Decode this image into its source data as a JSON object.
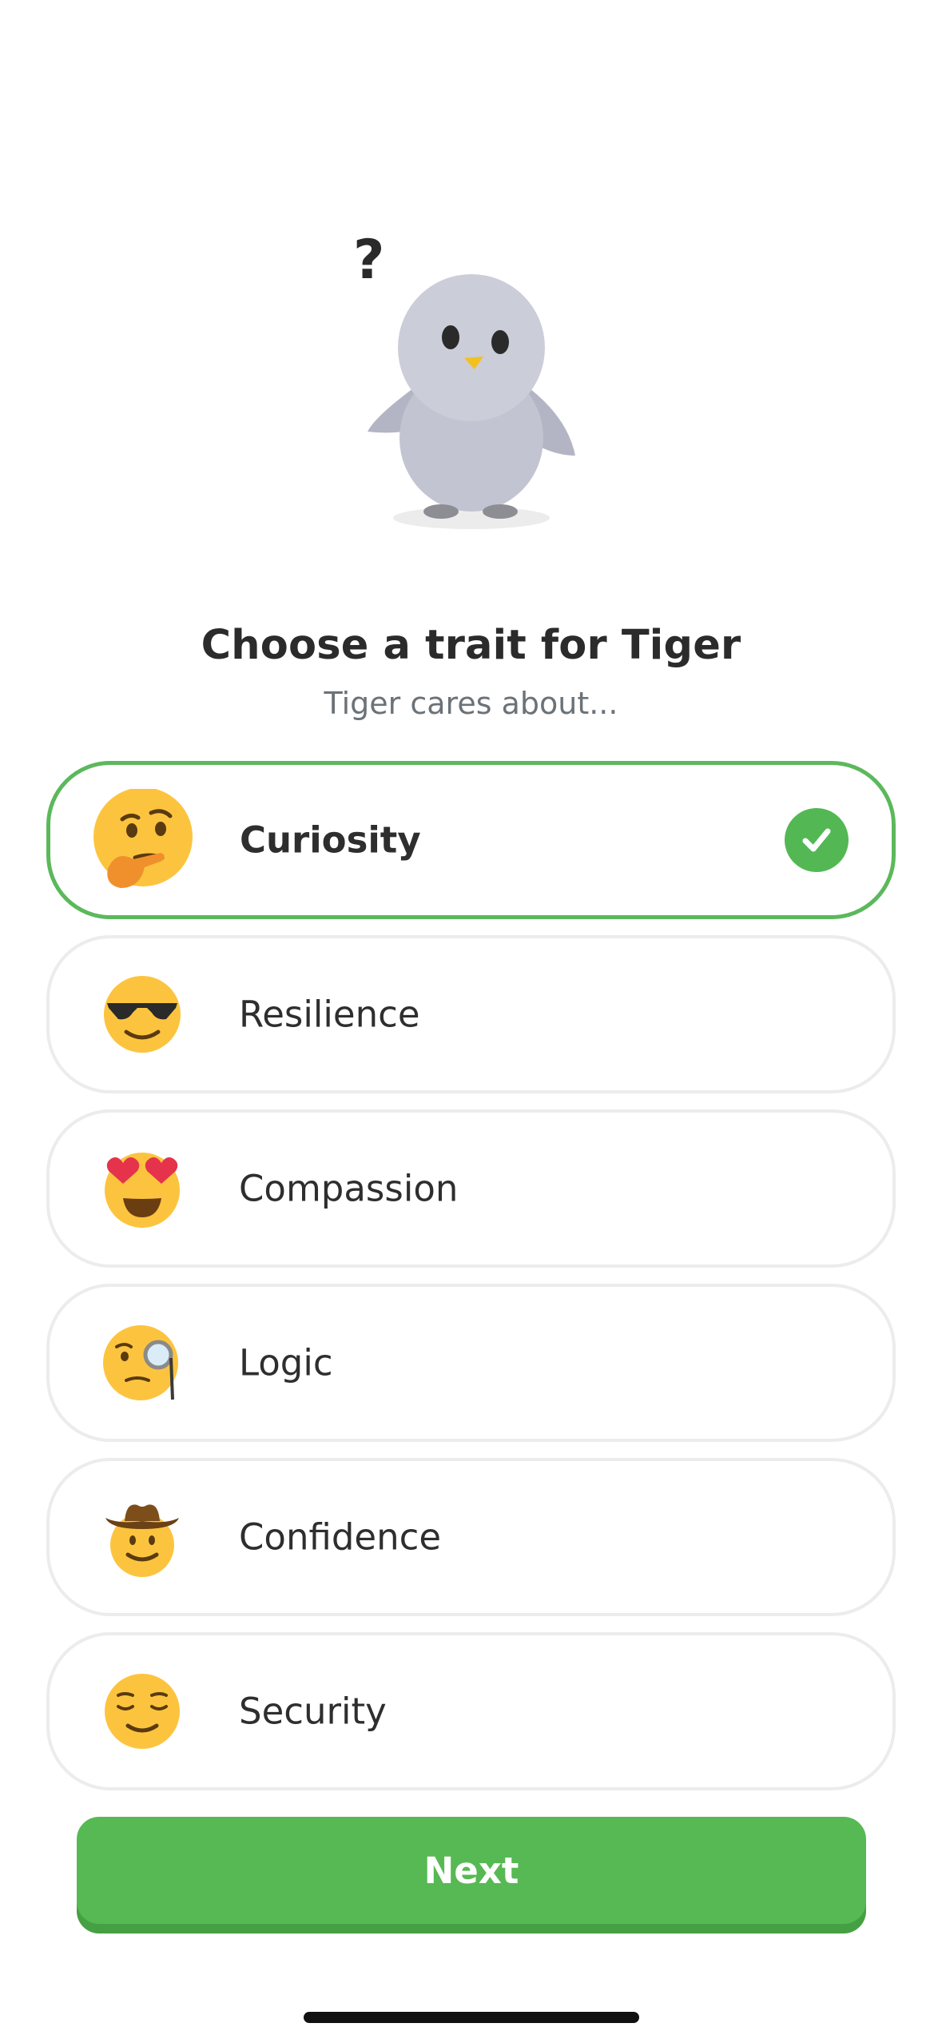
{
  "header": {
    "question_mark": "?",
    "title": "Choose a trait for Tiger",
    "subtitle": "Tiger cares about..."
  },
  "mascot": {
    "icon": "penguin-mascot-icon"
  },
  "options": [
    {
      "label": "Curiosity",
      "icon": "thinking-face-icon",
      "selected": true
    },
    {
      "label": "Resilience",
      "icon": "sunglasses-face-icon",
      "selected": false
    },
    {
      "label": "Compassion",
      "icon": "heart-eyes-face-icon",
      "selected": false
    },
    {
      "label": "Logic",
      "icon": "monocle-face-icon",
      "selected": false
    },
    {
      "label": "Confidence",
      "icon": "cowboy-face-icon",
      "selected": false
    },
    {
      "label": "Security",
      "icon": "relieved-face-icon",
      "selected": false
    }
  ],
  "footer": {
    "next_label": "Next"
  },
  "colors": {
    "accent_green": "#57b953",
    "selected_border": "#5cb85c",
    "unselected_border": "#ececec",
    "emoji_yellow": "#fcc43e"
  }
}
